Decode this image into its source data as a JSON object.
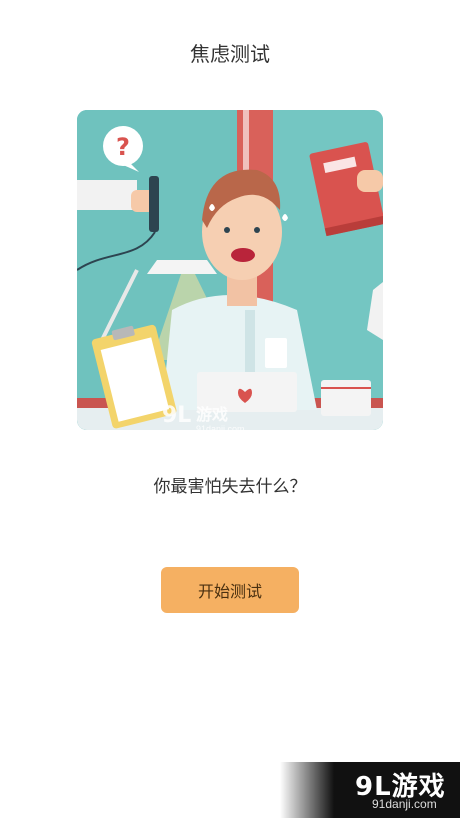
{
  "header": {
    "title": "焦虑测试"
  },
  "main": {
    "question": "你最害怕失去什么？",
    "start_button_label": "开始测试"
  },
  "watermark": {
    "logo_text": "9L游戏",
    "url": "91danji.com"
  },
  "colors": {
    "button_bg": "#f5b062",
    "hero_bg": "#74c6c2",
    "accent_red": "#d9534f"
  }
}
